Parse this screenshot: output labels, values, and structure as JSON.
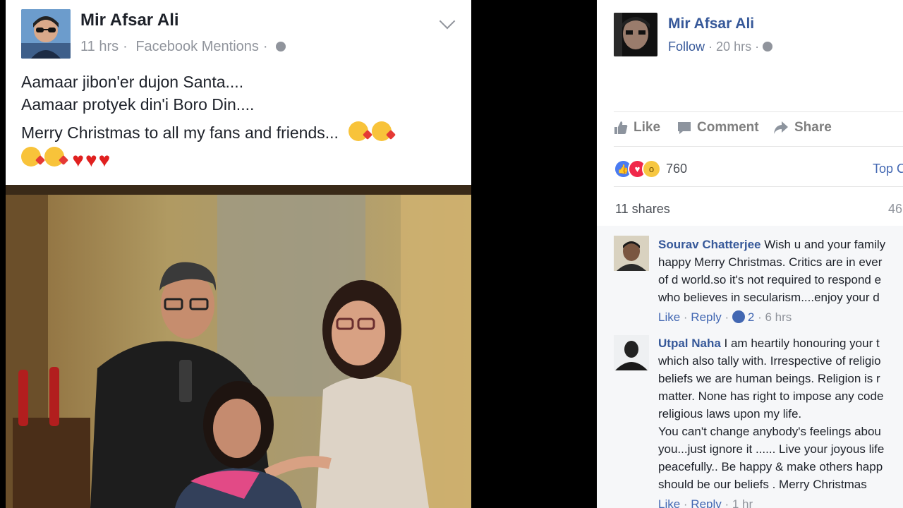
{
  "left_post": {
    "author": "Mir Afsar Ali",
    "time": "11 hrs",
    "source": "Facebook Mentions",
    "lines": [
      "Aamaar jibon'er dujon Santa....",
      "Aamaar protyek din'i Boro Din...."
    ],
    "christmas_line": "Merry Christmas to all my fans and friends...",
    "emoji": [
      "face-blowing-kiss",
      "face-blowing-kiss",
      "face-blowing-kiss",
      "face-blowing-kiss",
      "red-heart",
      "red-heart",
      "red-heart"
    ]
  },
  "right_post": {
    "author": "Mir Afsar Ali",
    "follow": "Follow",
    "time": "20 hrs",
    "actions": {
      "like": "Like",
      "comment": "Comment",
      "share": "Share"
    },
    "reaction_count": "760",
    "top_comments": "Top C",
    "shares": "11 shares",
    "comment_count": "46",
    "comments": [
      {
        "name": "Sourav Chatterjee",
        "lines": [
          "Wish u and your family",
          "happy Merry Christmas. Critics are in ever",
          "of d world.so it's not required to respond e",
          "who believes in secularism....enjoy your d"
        ],
        "like": "Like",
        "reply": "Reply",
        "reaction_count": "2",
        "time": "6 hrs"
      },
      {
        "name": "Utpal Naha",
        "lines": [
          "I am heartily honouring your t",
          "which also tally with. Irrespective of religio",
          "beliefs we are human beings. Religion is r",
          "matter. None has right to impose any code",
          "religious laws upon my life.",
          "You can't change anybody's feelings abou",
          "you...just ignore it ...... Live your joyous life",
          "peacefully.. Be happy & make others happ",
          "should be our beliefs . Merry Christmas"
        ],
        "like": "Like",
        "reply": "Reply",
        "time": "1 hr"
      }
    ]
  },
  "colors": {
    "link": "#365899",
    "meta": "#90949c",
    "like_blue": "#4267b2"
  }
}
